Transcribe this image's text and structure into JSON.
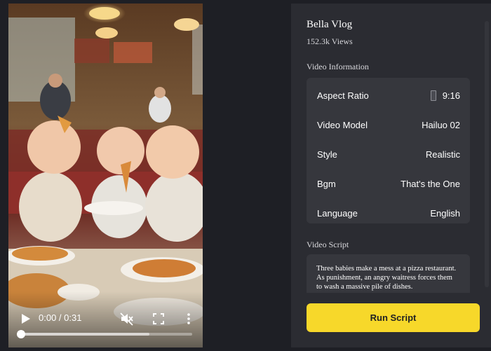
{
  "player": {
    "time_display": "0:00 / 0:31",
    "progress_fraction": 0.0,
    "buffered_fraction": 0.75
  },
  "video": {
    "title": "Bella Vlog",
    "views": "152.3k Views"
  },
  "info": {
    "section_label": "Video Information",
    "rows": [
      {
        "label": "Aspect Ratio",
        "value": "9:16",
        "icon": "phone-portrait-icon"
      },
      {
        "label": "Video Model",
        "value": "Hailuo 02"
      },
      {
        "label": "Style",
        "value": "Realistic"
      },
      {
        "label": "Bgm",
        "value": "That's the One"
      },
      {
        "label": "Language",
        "value": "English"
      }
    ]
  },
  "script": {
    "section_label": "Video Script",
    "text": "Three babies make a mess at a pizza restaurant. As punishment, an angry waitress forces them to wash a massive pile of dishes."
  },
  "actions": {
    "run_label": "Run Script"
  },
  "colors": {
    "page_bg": "#1e1f25",
    "panel_bg": "#2b2c32",
    "card_bg": "#36373d",
    "accent": "#f7d82a"
  }
}
